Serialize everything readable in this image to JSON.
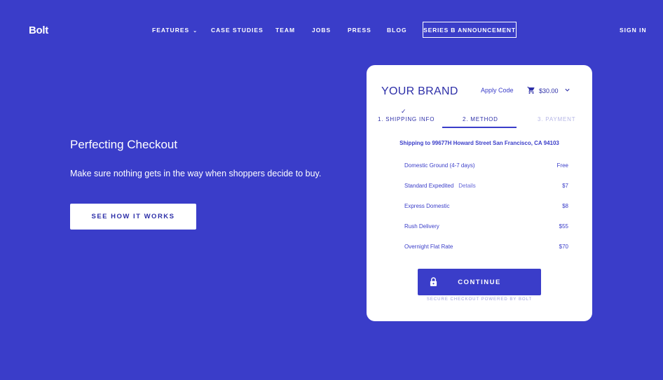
{
  "header": {
    "logo": "Bolt",
    "nav": [
      {
        "label": "FEATURES",
        "chevron": "⌄"
      },
      {
        "label": "CASE STUDIES"
      },
      {
        "label": "TEAM"
      },
      {
        "label": "JOBS"
      },
      {
        "label": "PRESS"
      },
      {
        "label": "BLOG"
      }
    ],
    "announcement": "SERIES B ANNOUNCEMENT",
    "sign_in": "SIGN IN"
  },
  "hero": {
    "title": "Perfecting Checkout",
    "subtitle": "Make sure nothing gets in the way when shoppers decide to buy.",
    "cta": "SEE HOW IT WORKS"
  },
  "checkout": {
    "brand": "YOUR BRAND",
    "apply_code": "Apply Code",
    "cart_total": "$30.00",
    "step_check": "✓",
    "steps": [
      "1. SHIPPING INFO",
      "2. METHOD",
      "3. PAYMENT"
    ],
    "ship_to": "Shipping to 99677H Howard Street San Francisco, CA 94103",
    "options": [
      {
        "name": "Domestic Ground (4-7 days)",
        "details": "",
        "price": "Free"
      },
      {
        "name": "Standard Expedited",
        "details": "Details",
        "price": "$7"
      },
      {
        "name": "Express Domestic",
        "details": "",
        "price": "$8"
      },
      {
        "name": "Rush Delivery",
        "details": "",
        "price": "$55"
      },
      {
        "name": "Overnight Flat Rate",
        "details": "",
        "price": "$70"
      }
    ],
    "continue": "CONTINUE",
    "secure_note": "SECURE CHECKOUT POWERED BY BOLT"
  },
  "colors": {
    "background": "#3a3dc9",
    "accent": "#2d2fa8",
    "card": "#ffffff"
  }
}
